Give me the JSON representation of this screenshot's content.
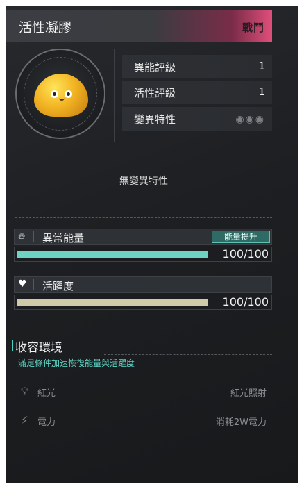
{
  "header": {
    "title": "活性凝膠",
    "tag": "戰鬥"
  },
  "portrait": {
    "icon": "yellow-slime-icon"
  },
  "stats": [
    {
      "label": "異能評級",
      "value": "1"
    },
    {
      "label": "活性評級",
      "value": "1"
    },
    {
      "label": "變異特性",
      "value": ""
    }
  ],
  "traits": {
    "empty_text": "無變異特性",
    "icon": "eye-icon"
  },
  "energy": {
    "icon": "flame-icon",
    "label": "異常能量",
    "boost_label": "能量提升",
    "value": "100/100",
    "fill_fraction": 1.0,
    "color": "#6fd3c3"
  },
  "activity": {
    "icon": "heart-pulse-icon",
    "label": "活躍度",
    "value": "100/100",
    "fill_fraction": 1.0,
    "color": "#cfcaa8"
  },
  "environment": {
    "title": "收容環境",
    "subtitle": "滿足條件加速恢復能量與活躍度",
    "rows": [
      {
        "icon": "lightbulb-icon",
        "label": "紅光",
        "value": "紅光照射"
      },
      {
        "icon": "lightning-icon",
        "label": "電力",
        "value": "消耗2W電力"
      }
    ]
  },
  "colors": {
    "accent_pink": "#e04f7c",
    "accent_teal": "#5ed7c6"
  }
}
